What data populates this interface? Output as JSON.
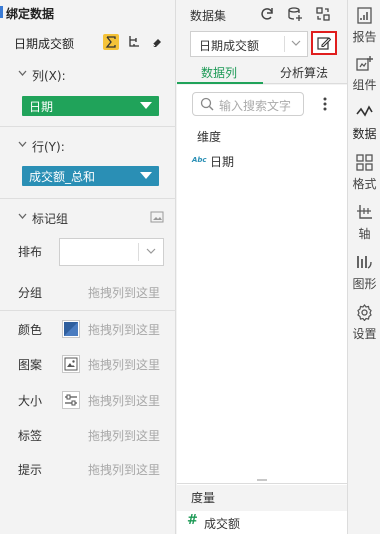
{
  "left_panel": {
    "title": "绑定数据",
    "dataset_name": "日期成交额",
    "columns_label": "列(X):",
    "columns_field": "日期",
    "rows_label": "行(Y):",
    "rows_field": "成交额_总和",
    "marks_label": "标记组",
    "layout_label": "排布",
    "layout_value": "",
    "group_label": "分组",
    "color_label": "颜色",
    "pattern_label": "图案",
    "size_label": "大小",
    "tag_label": "标签",
    "tip_label": "提示",
    "drop_hint": "拖拽列到这里",
    "pill_colors": {
      "columns": "#20a35a",
      "rows": "#2a8fb5"
    }
  },
  "mid_panel": {
    "title": "数据集",
    "dataset_value": "日期成交额",
    "tabs": [
      {
        "label": "数据列",
        "active": true
      },
      {
        "label": "分析算法",
        "active": false
      }
    ],
    "search_placeholder": "输入搜索文字",
    "dimension_header": "维度",
    "dimension_fields": [
      {
        "type_badge": "Abc",
        "name": "日期"
      }
    ],
    "measure_header": "度量",
    "measure_fields": [
      {
        "type_badge": "#",
        "name": "成交额"
      }
    ],
    "accent_color": "#20a35a",
    "highlight_color": "#e01e1e"
  },
  "rail": {
    "items": [
      {
        "label": "报告",
        "icon": "report-icon"
      },
      {
        "label": "组件",
        "icon": "component-icon"
      },
      {
        "label": "数据",
        "icon": "data-icon"
      },
      {
        "label": "格式",
        "icon": "format-icon"
      },
      {
        "label": "轴",
        "icon": "axis-icon"
      },
      {
        "label": "图形",
        "icon": "graph-icon"
      },
      {
        "label": "设置",
        "icon": "settings-icon"
      }
    ]
  }
}
